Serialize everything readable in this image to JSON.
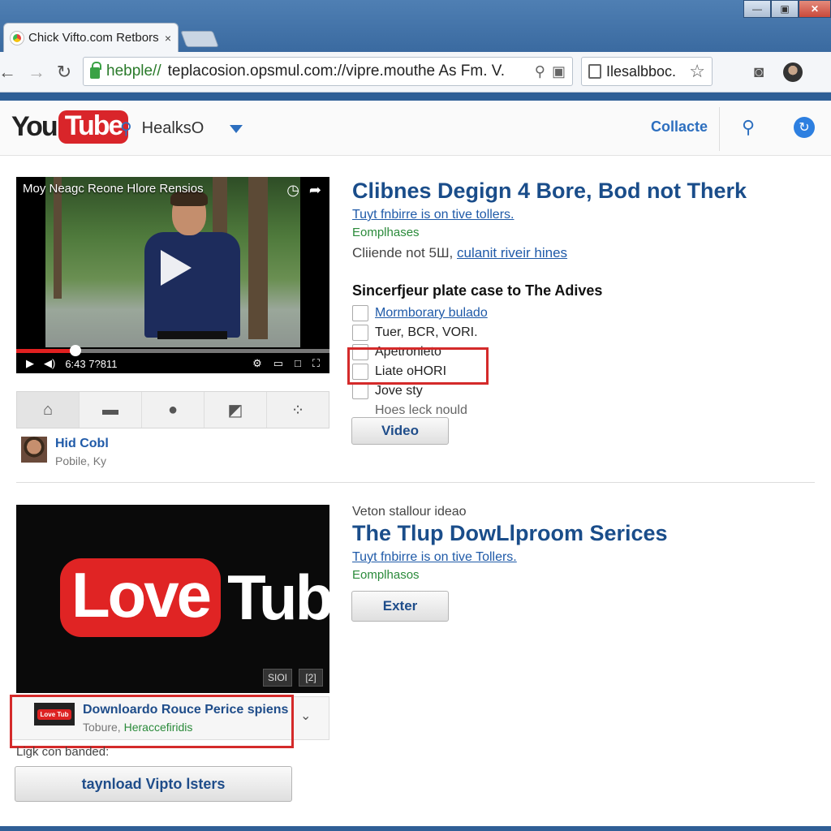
{
  "browser": {
    "tab_title": "Chick Vifto.com Retbors",
    "tab_close": "×",
    "url_scheme": "hebple//",
    "url_rest": "teplacosion.opsmul.com://vipre.mouthe As Fm. V.",
    "search_box_text": "Ilesalbboc.",
    "window_controls": [
      "—",
      "▣",
      "✕"
    ]
  },
  "header": {
    "logo_you": "You",
    "logo_tube": "Tube",
    "search_text": "HealksO",
    "link_label": "Collacte"
  },
  "video1": {
    "player_title": "Moy Neagc Reone Hlore Rensios",
    "time": "6:43 7?811",
    "progress": 0.19,
    "title": "Clibnes Degign 4 Bore, Bod not Therk",
    "subtitle": "Tuyt fnbirre is on tive tollers.",
    "category": "Eomplhases",
    "meta_text": "Cliiende not 5Ш,",
    "meta_link": "culanit riveir hines",
    "list_heading": "Sincerfjeur plate case to The Adives",
    "checklist": [
      {
        "label": "Mormborary bulado",
        "style": "link",
        "checkbox": true
      },
      {
        "label": "Tuer, BCR, VORI.",
        "style": "normal",
        "checkbox": true
      },
      {
        "label": "Apetronieto",
        "style": "normal",
        "checkbox": true
      },
      {
        "label": "Liate oHORI",
        "style": "normal",
        "checkbox": true
      },
      {
        "label": "Jove sty",
        "style": "normal",
        "checkbox": true
      },
      {
        "label": "Hoes leck nould",
        "style": "plain",
        "checkbox": false
      }
    ],
    "button_label": "Video",
    "channel_name": "Hid Cobl",
    "channel_location": "Pobile, Ky"
  },
  "video2": {
    "logo_love": "Love",
    "logo_tub": "Tub",
    "badge_1": "SIOI",
    "badge_2": "[2]",
    "pre_title": "Veton stallour ideao",
    "title": "The Tlup DowLlproom Serices",
    "subtitle": "Tuyt fnbirre is on tive Tollers.",
    "category": "Eomplhasos",
    "button_label": "Exter",
    "download_thumb": "Love Tub",
    "download_title": "Downloardo Rouce Perice spiens",
    "download_sub_prefix": "Tobure,",
    "download_sub_green": "Heraccefiridis",
    "small_label": "Ligk con banded:",
    "wide_button_label": "taynload Vipto lsters"
  }
}
